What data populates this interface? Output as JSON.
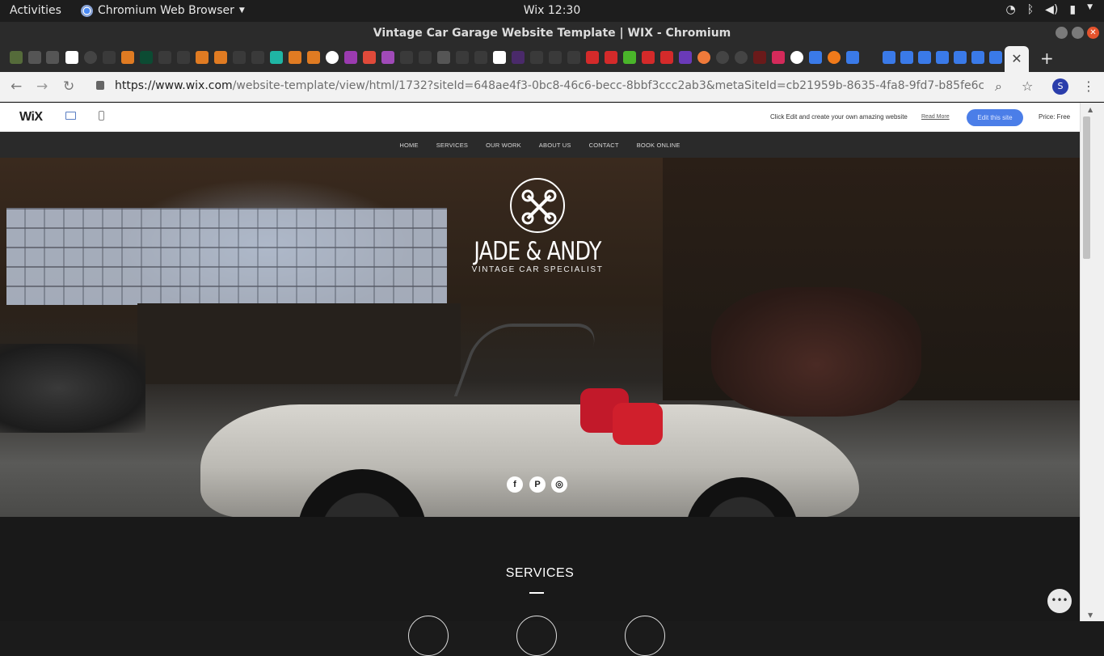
{
  "system": {
    "activities": "Activities",
    "app_name": "Chromium Web Browser",
    "clock": "Wix 12:30"
  },
  "browser": {
    "window_title": "Vintage Car Garage Website Template | WIX - Chromium",
    "url_host": "https://www.wix.com",
    "url_path": "/website-template/view/html/1732?siteId=648ae4f3-0bc8-46c6-becc-8bbf3ccc2ab3&metaSiteId=cb21959b-8635-4fa8-9fd7-b85fe6cd7f3c&origin...",
    "profile_initial": "S"
  },
  "wix_bar": {
    "logo": "WiX",
    "promo_text": "Click Edit and create your own amazing website",
    "read_more": "Read More",
    "edit_button": "Edit this site",
    "price": "Price: Free"
  },
  "site": {
    "nav": [
      "HOME",
      "SERVICES",
      "OUR WORK",
      "ABOUT US",
      "CONTACT",
      "BOOK ONLINE"
    ],
    "brand_name": "JADE & ANDY",
    "tagline": "VINTAGE CAR SPECIALIST",
    "social": [
      {
        "name": "facebook",
        "glyph": "f"
      },
      {
        "name": "pinterest",
        "glyph": "P"
      },
      {
        "name": "instagram",
        "glyph": "◎"
      }
    ],
    "services_title": "SERVICES"
  },
  "colors": {
    "edit_button": "#4b7ee8",
    "site_nav_bg": "#2a2a2a",
    "services_bg": "#191919",
    "seat_red": "#c2192a"
  }
}
